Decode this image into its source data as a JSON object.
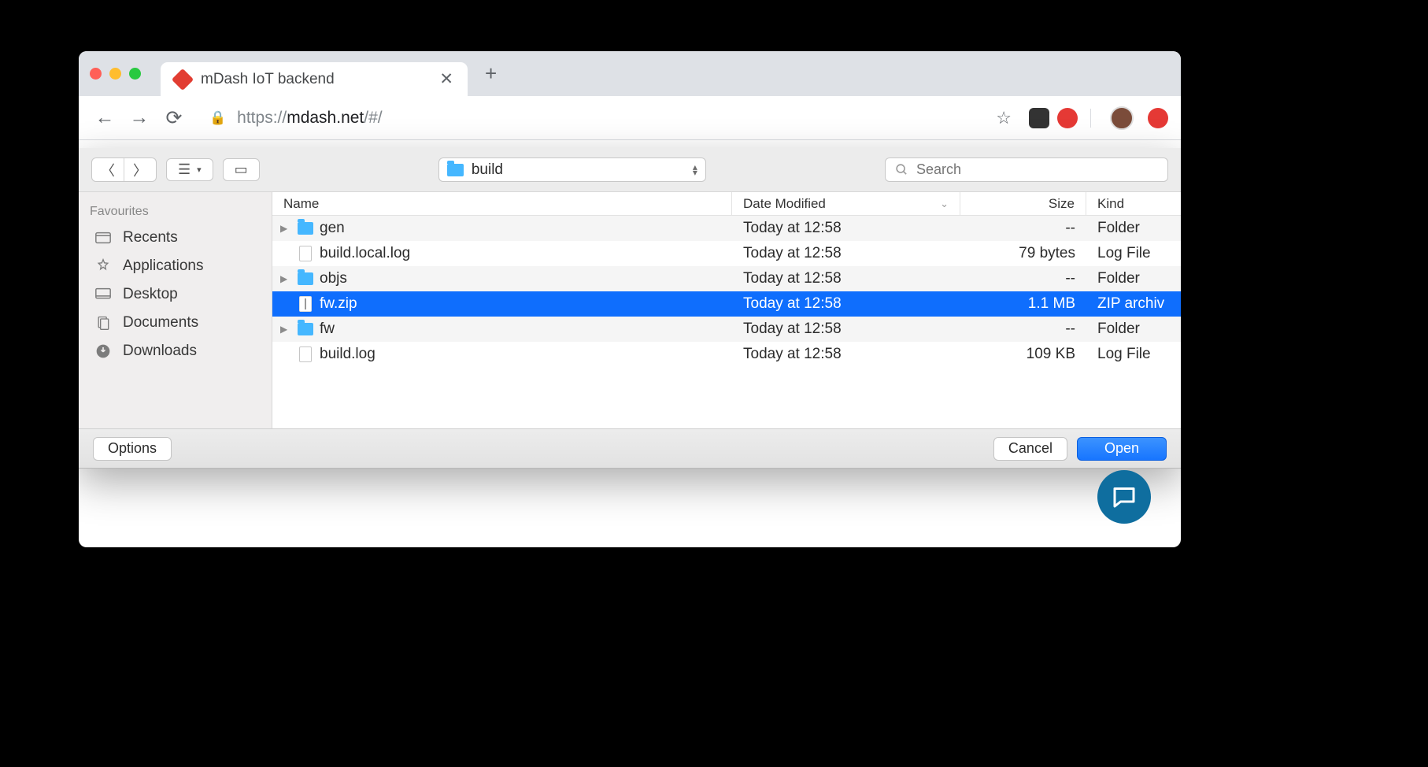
{
  "browser": {
    "tab_title": "mDash IoT backend",
    "url_prefix": "https://",
    "url_host": "mdash.net",
    "url_path": "/#/"
  },
  "finder": {
    "location": "build",
    "search_placeholder": "Search",
    "sidebar": {
      "header": "Favourites",
      "items": [
        {
          "label": "Recents",
          "icon": "recents"
        },
        {
          "label": "Applications",
          "icon": "applications"
        },
        {
          "label": "Desktop",
          "icon": "desktop"
        },
        {
          "label": "Documents",
          "icon": "documents"
        },
        {
          "label": "Downloads",
          "icon": "downloads"
        }
      ]
    },
    "columns": {
      "name": "Name",
      "date": "Date Modified",
      "size": "Size",
      "kind": "Kind"
    },
    "rows": [
      {
        "name": "gen",
        "type": "folder",
        "date": "Today at 12:58",
        "size": "--",
        "kind": "Folder",
        "expandable": true,
        "selected": false
      },
      {
        "name": "build.local.log",
        "type": "log",
        "date": "Today at 12:58",
        "size": "79 bytes",
        "kind": "Log File",
        "expandable": false,
        "selected": false
      },
      {
        "name": "objs",
        "type": "folder",
        "date": "Today at 12:58",
        "size": "--",
        "kind": "Folder",
        "expandable": true,
        "selected": false
      },
      {
        "name": "fw.zip",
        "type": "zip",
        "date": "Today at 12:58",
        "size": "1.1 MB",
        "kind": "ZIP archiv",
        "expandable": false,
        "selected": true
      },
      {
        "name": "fw",
        "type": "folder",
        "date": "Today at 12:58",
        "size": "--",
        "kind": "Folder",
        "expandable": true,
        "selected": false
      },
      {
        "name": "build.log",
        "type": "log",
        "date": "Today at 12:58",
        "size": "109 KB",
        "kind": "Log File",
        "expandable": false,
        "selected": false
      }
    ],
    "buttons": {
      "options": "Options",
      "cancel": "Cancel",
      "open": "Open"
    }
  }
}
